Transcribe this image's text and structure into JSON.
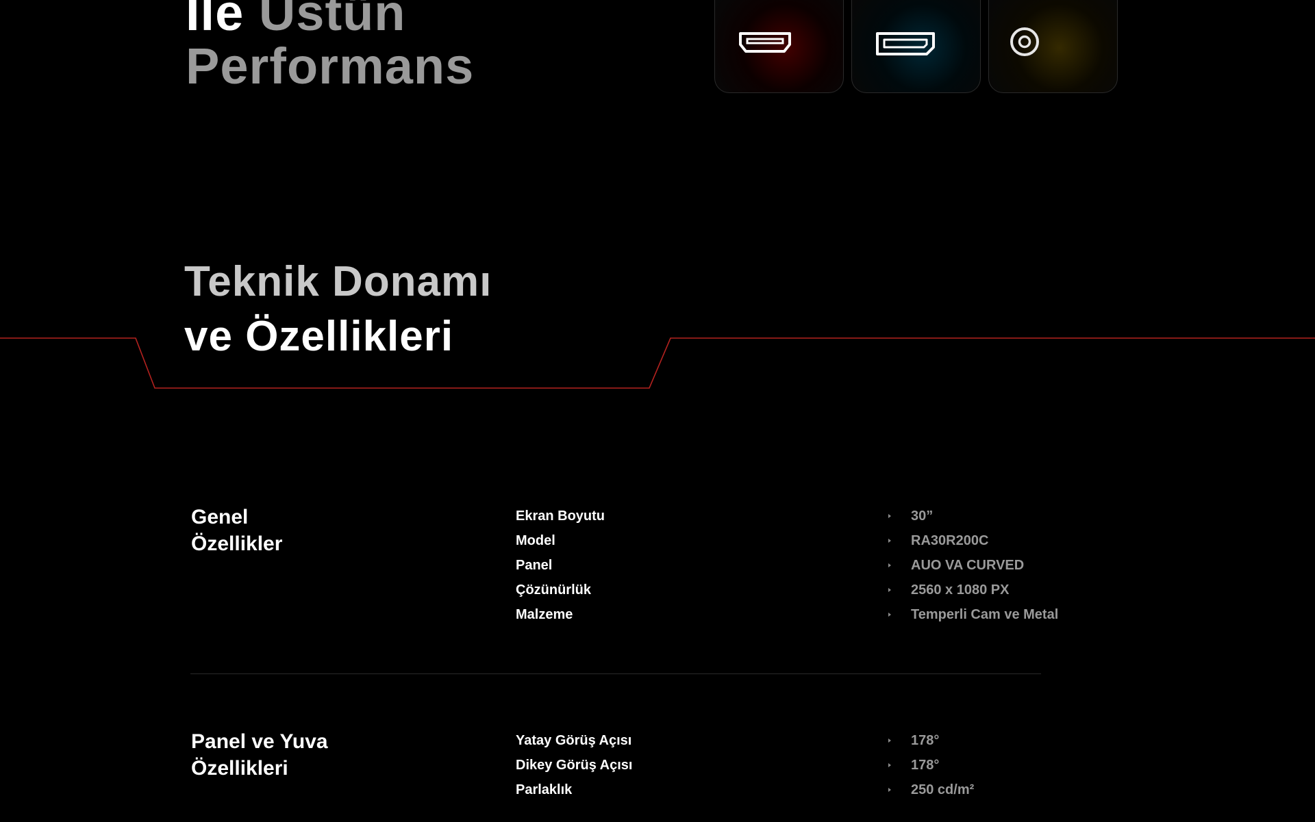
{
  "hero": {
    "line1_white": "İle",
    "line1_gray": "Üstün",
    "line2_gray": "Performans"
  },
  "ports": [
    {
      "icon": "hdmi-port-icon",
      "glow": "#7a0000"
    },
    {
      "icon": "displayport-icon",
      "glow": "#00465f"
    },
    {
      "icon": "audio-jack-icon",
      "glow": "#5f4b00"
    }
  ],
  "section": {
    "title_line1": "Teknik Donamı",
    "title_line2": "ve Özellikleri",
    "accent_color": "#b4221f"
  },
  "groups": [
    {
      "title_line1": "Genel",
      "title_line2": "Özellikler",
      "specs": [
        {
          "label": "Ekran Boyutu",
          "value": "30”"
        },
        {
          "label": "Model",
          "value": "RA30R200C"
        },
        {
          "label": "Panel",
          "value": "AUO VA CURVED"
        },
        {
          "label": "Çözünürlük",
          "value": "2560 x 1080 PX"
        },
        {
          "label": "Malzeme",
          "value": "Temperli Cam ve Metal"
        }
      ]
    },
    {
      "title_line1": "Panel ve Yuva",
      "title_line2": "Özellikleri",
      "specs": [
        {
          "label": "Yatay Görüş Açısı",
          "value": "178°"
        },
        {
          "label": "Dikey Görüş Açısı",
          "value": "178°"
        },
        {
          "label": "Parlaklık",
          "value": "250 cd/m²"
        }
      ]
    }
  ]
}
